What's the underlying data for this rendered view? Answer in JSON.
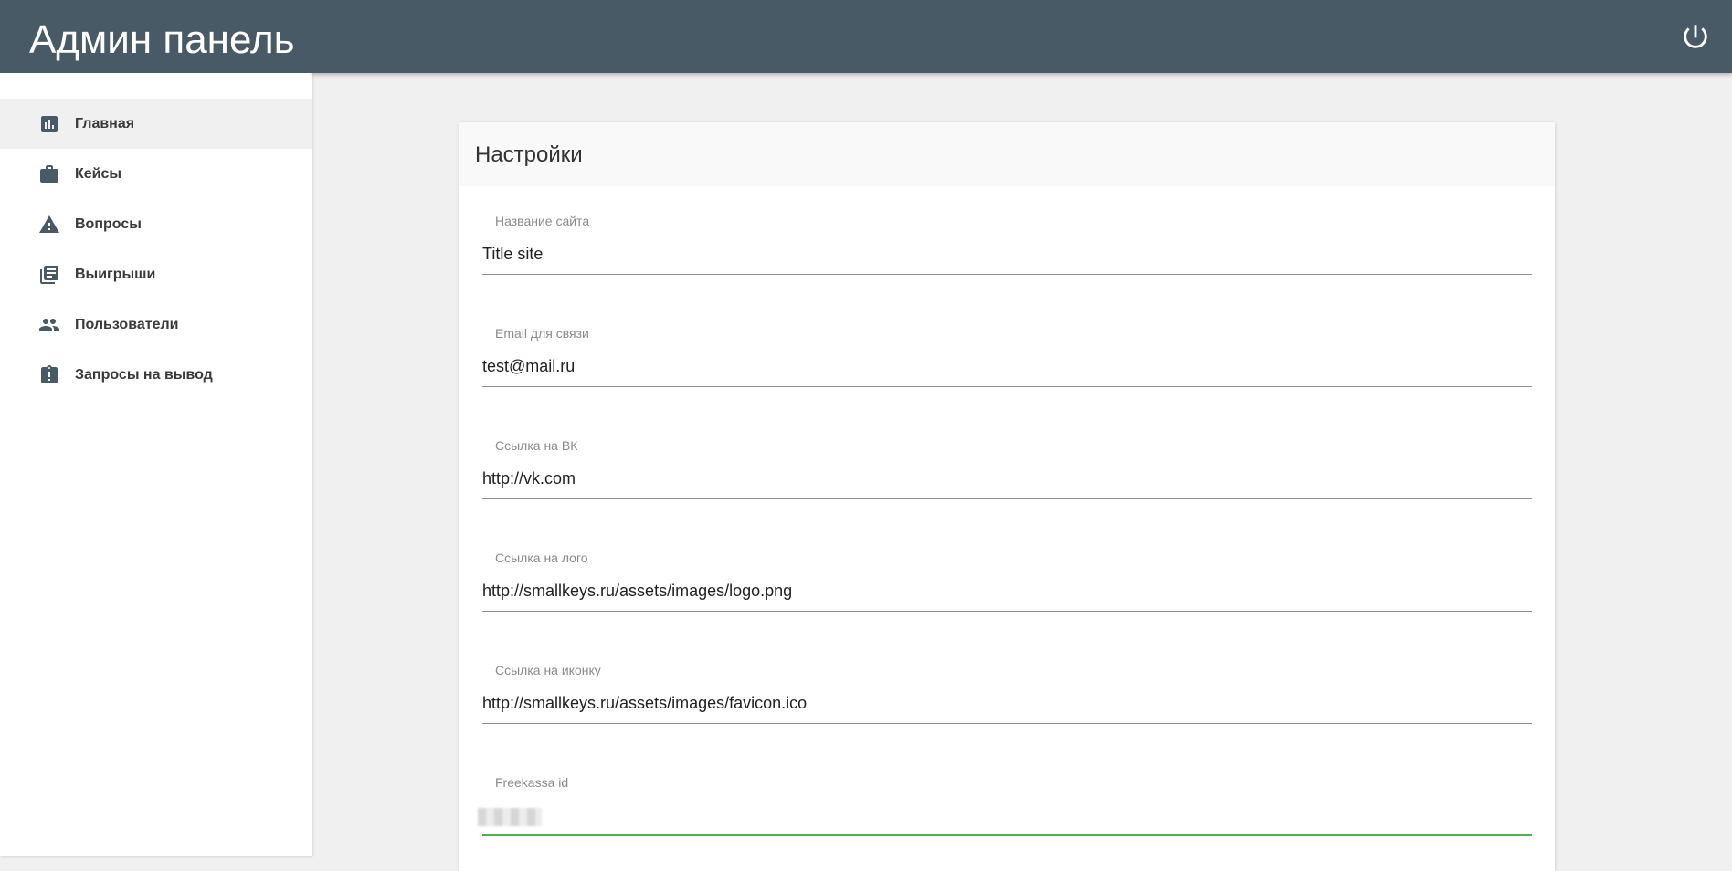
{
  "app": {
    "title": "Админ панель"
  },
  "header": {
    "power_icon": "power-icon"
  },
  "sidebar": {
    "items": [
      {
        "label": "Главная",
        "icon": "bar-chart-icon",
        "active": true
      },
      {
        "label": "Кейсы",
        "icon": "briefcase-icon",
        "active": false
      },
      {
        "label": "Вопросы",
        "icon": "warning-icon",
        "active": false
      },
      {
        "label": "Выигрыши",
        "icon": "library-books-icon",
        "active": false
      },
      {
        "label": "Пользователи",
        "icon": "people-icon",
        "active": false
      },
      {
        "label": "Запросы на вывод",
        "icon": "clipboard-alert-icon",
        "active": false
      }
    ]
  },
  "settings": {
    "title": "Настройки",
    "fields": [
      {
        "label": "Название сайта",
        "value": "Title site"
      },
      {
        "label": "Email для связи",
        "value": "test@mail.ru"
      },
      {
        "label": "Ссылка на ВК",
        "value": "http://vk.com"
      },
      {
        "label": "Ссылка на лого",
        "value": "http://smallkeys.ru/assets/images/logo.png"
      },
      {
        "label": "Ссылка на иконку",
        "value": "http://smallkeys.ru/assets/images/favicon.ico"
      },
      {
        "label": "Freekassa id",
        "value": ""
      }
    ]
  },
  "colors": {
    "header_bg": "#475a66",
    "active_underline": "#4caf50"
  }
}
